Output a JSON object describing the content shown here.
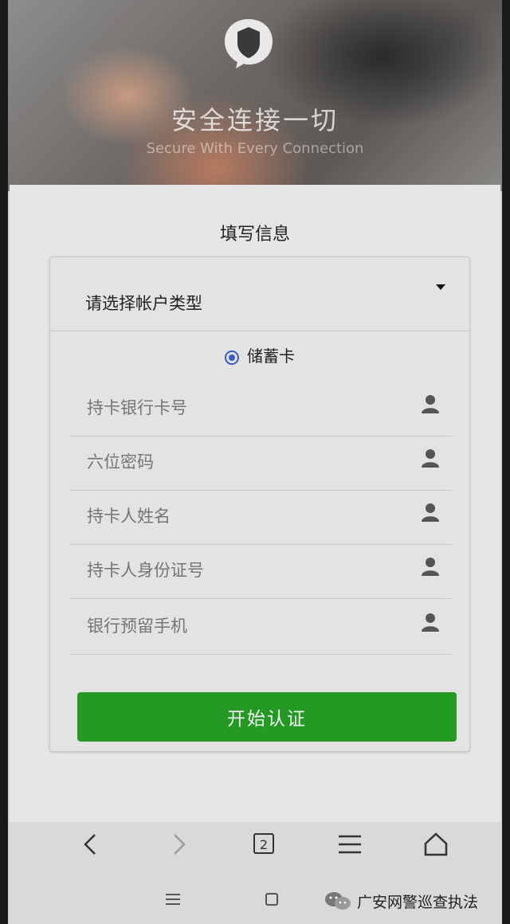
{
  "hero": {
    "title": "安全连接一切",
    "subtitle": "Secure With Every Connection"
  },
  "form": {
    "title": "填写信息",
    "account_type_placeholder": "请选择帐户类型",
    "card_type_label": "储蓄卡",
    "fields": [
      {
        "placeholder": "持卡银行卡号",
        "icon": "person-icon"
      },
      {
        "placeholder": "六位密码",
        "icon": "person-icon"
      },
      {
        "placeholder": "持卡人姓名",
        "icon": "person-icon"
      },
      {
        "placeholder": "持卡人身份证号",
        "icon": "person-icon"
      },
      {
        "placeholder": "银行预留手机",
        "icon": "person-icon"
      }
    ],
    "submit_label": "开始认证"
  },
  "browser_nav": {
    "tab_count": "2"
  },
  "watermark": {
    "text": "广安网警巡查执法"
  },
  "colors": {
    "submit_bg": "#249a25",
    "radio_accent": "#3a5cc7"
  }
}
